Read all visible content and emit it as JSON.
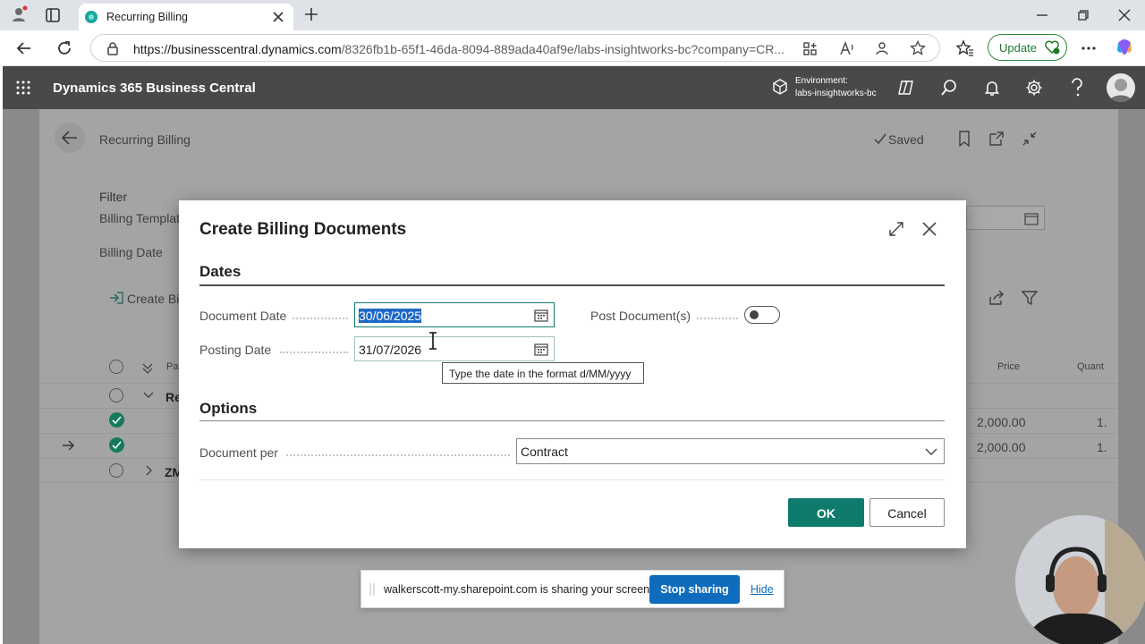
{
  "browser": {
    "tab_title": "Recurring Billing",
    "url_host": "https://businesscentral.dynamics.com",
    "url_path": "/8326fb1b-65f1-46da-8094-889ada40af9e/labs-insightworks-bc?company=CR...",
    "update_label": "Update"
  },
  "app": {
    "name": "Dynamics 365 Business Central",
    "environment_label": "Environment:",
    "environment_name": "labs-insightworks-bc"
  },
  "page": {
    "title": "Recurring Billing",
    "saved_label": "Saved",
    "filter_label": "Filter",
    "billing_template_label": "Billing Templat",
    "billing_date_label": "Billing Date",
    "create_action": "Create Bil",
    "col_pa": "Pa",
    "col_price": "Price",
    "col_quantity": "Quant",
    "group1_label": "Re",
    "group2_label": "ZM",
    "row1_price": "2,000.00",
    "row1_qty": "1.",
    "row2_price": "2,000.00",
    "row2_qty": "1."
  },
  "dialog": {
    "title": "Create Billing Documents",
    "dates_section": "Dates",
    "document_date_label": "Document Date",
    "document_date_value": "30/06/2025",
    "posting_date_label": "Posting Date",
    "posting_date_value": "31/07/2026",
    "post_documents_label": "Post Document(s)",
    "post_documents_enabled": false,
    "tooltip": "Type the date in the format d/MM/yyyy",
    "options_section": "Options",
    "document_per_label": "Document per",
    "document_per_value": "Contract",
    "ok_label": "OK",
    "cancel_label": "Cancel"
  },
  "sharebar": {
    "message": "walkerscott-my.sharepoint.com is sharing your screen.",
    "stop_label": "Stop sharing",
    "hide_label": "Hide"
  },
  "colors": {
    "primary_button": "#0f7b6c",
    "app_header": "#484a49",
    "selection": "#1e69c8",
    "share_button": "#0f6cbd"
  }
}
